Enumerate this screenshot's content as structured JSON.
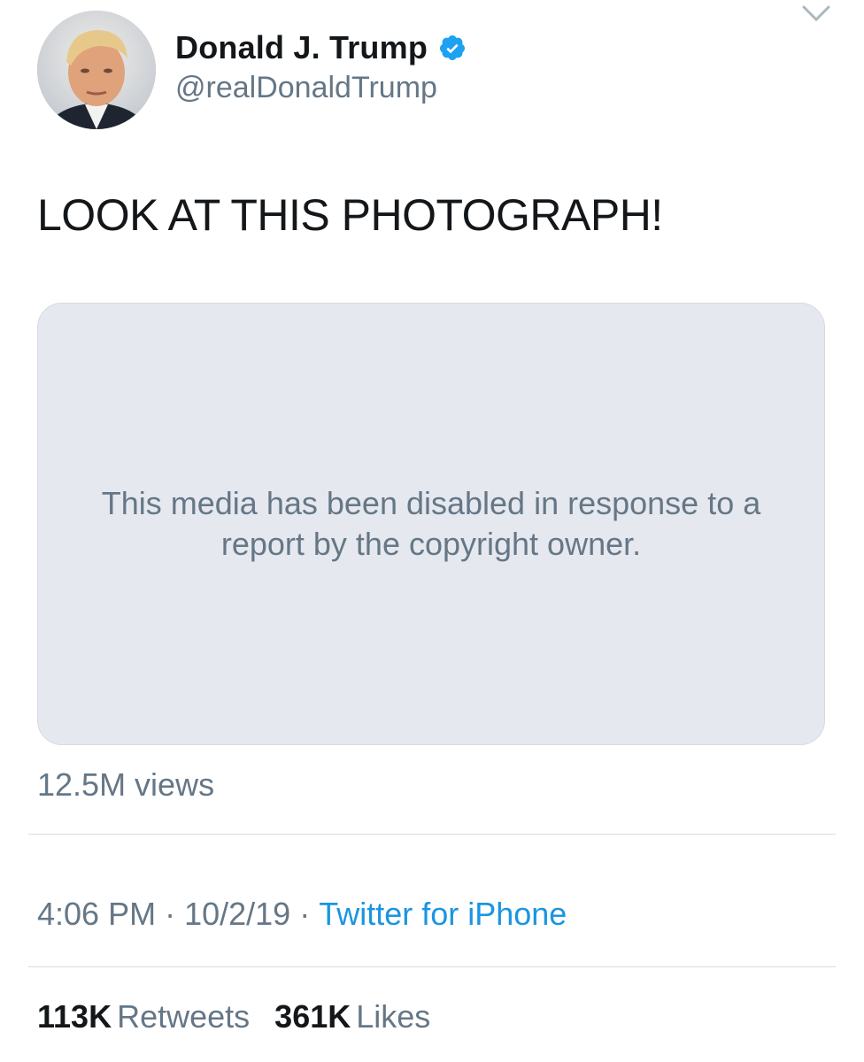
{
  "user": {
    "display_name": "Donald J. Trump",
    "handle": "@realDonaldTrump",
    "verified": true,
    "avatar_icon": "profile-photo",
    "verified_color": "#1da1f2"
  },
  "tweet": {
    "text": "LOOK AT THIS PHOTOGRAPH!",
    "media_message": "This media has been disabled in response to a report by the copyright owner.",
    "views": "12.5M views"
  },
  "meta": {
    "time": "4:06 PM",
    "date": "10/2/19",
    "separator": "·",
    "source": "Twitter for iPhone"
  },
  "stats": {
    "retweets_count": "113K",
    "retweets_label": "Retweets",
    "likes_count": "361K",
    "likes_label": "Likes"
  },
  "colors": {
    "text": "#14171a",
    "secondary": "#657786",
    "link": "#1b95e0",
    "media_bg": "#e6e8ef"
  }
}
